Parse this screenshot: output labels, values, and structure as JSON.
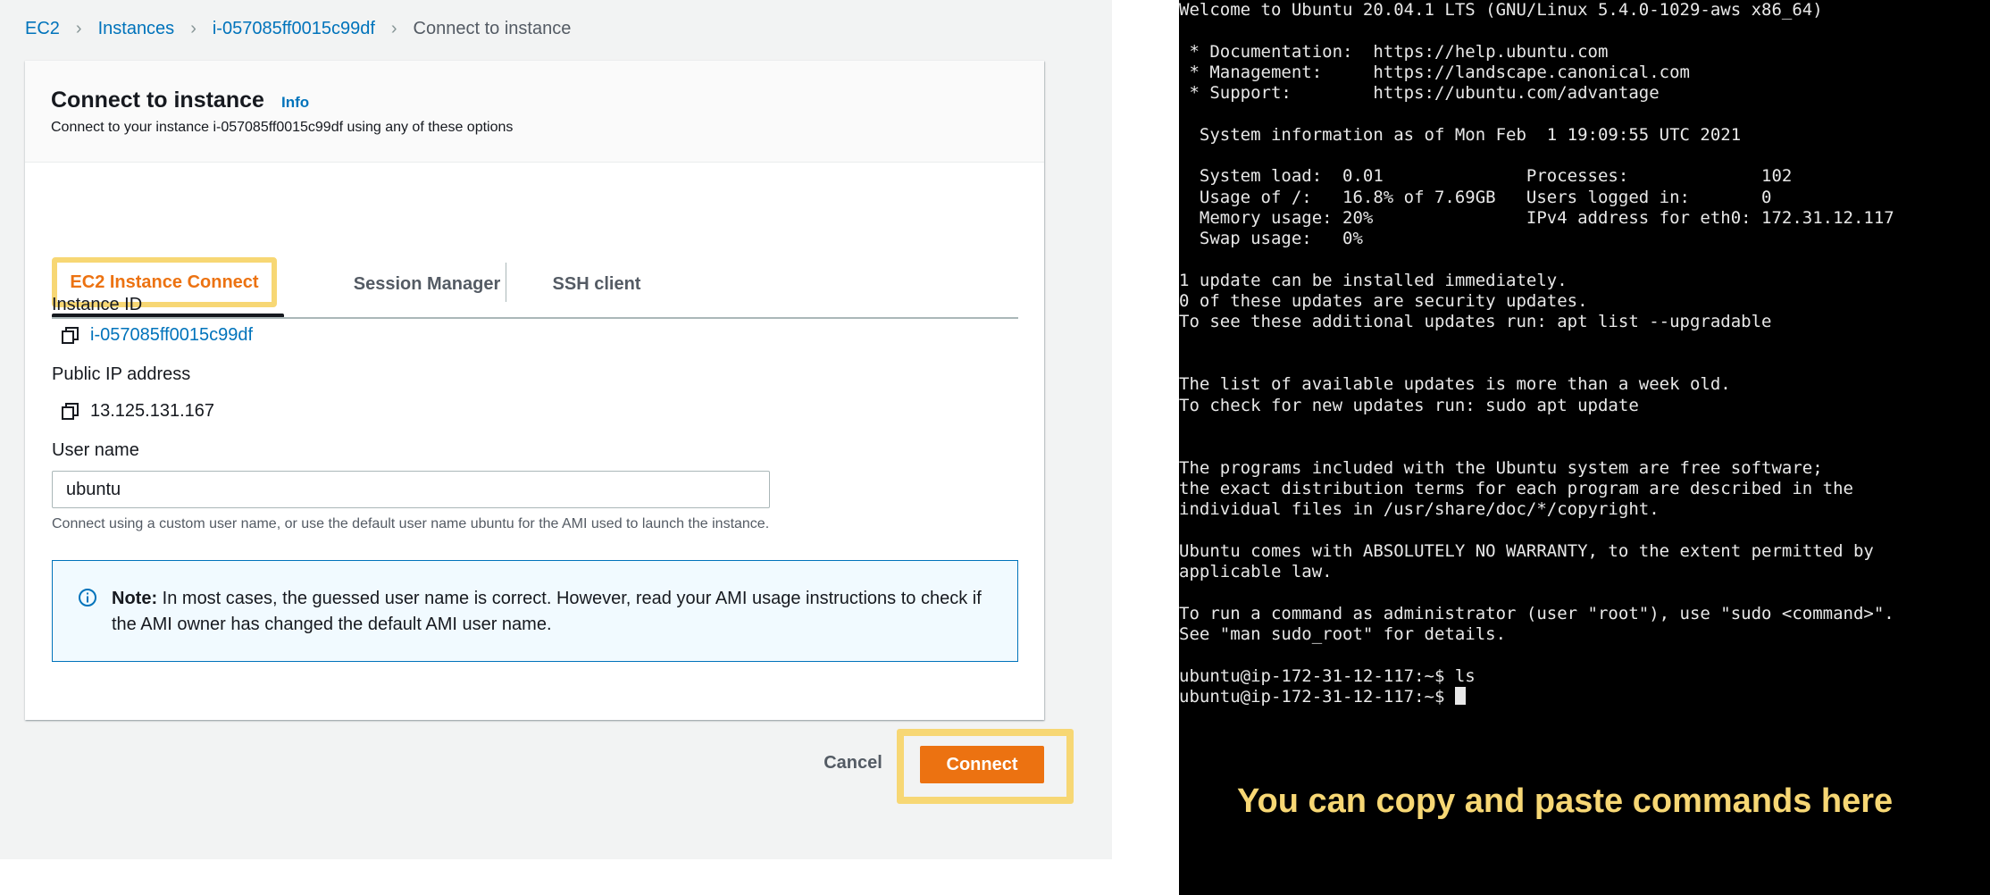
{
  "breadcrumb": {
    "items": [
      "EC2",
      "Instances",
      "i-057085ff0015c99df"
    ],
    "current": "Connect to instance"
  },
  "card": {
    "title": "Connect to instance",
    "info_link": "Info",
    "description": "Connect to your instance i-057085ff0015c99df using any of these options"
  },
  "tabs": [
    {
      "label": "EC2 Instance Connect",
      "selected": true
    },
    {
      "label": "Session Manager",
      "selected": false
    },
    {
      "label": "SSH client",
      "selected": false
    }
  ],
  "fields": {
    "instance_id_label": "Instance ID",
    "instance_id_value": "i-057085ff0015c99df",
    "public_ip_label": "Public IP address",
    "public_ip_value": "13.125.131.167",
    "username_label": "User name",
    "username_value": "ubuntu",
    "username_hint": "Connect using a custom user name, or use the default user name ubuntu for the AMI used to launch the instance."
  },
  "note": {
    "bold": "Note:",
    "text": " In most cases, the guessed user name is correct. However, read your AMI usage instructions to check if the AMI owner has changed the default AMI user name."
  },
  "actions": {
    "cancel_label": "Cancel",
    "connect_label": "Connect"
  },
  "colors": {
    "accent_orange": "#ec7211",
    "link_blue": "#0073bb",
    "highlight_yellow": "#f7d774",
    "terminal_bg": "#000000"
  },
  "icons": [
    "copy-icon",
    "info-circle-icon",
    "chevron-right-icon",
    "terminal-cursor"
  ],
  "terminal": {
    "lines": [
      "Welcome to Ubuntu 20.04.1 LTS (GNU/Linux 5.4.0-1029-aws x86_64)",
      "",
      " * Documentation:  https://help.ubuntu.com",
      " * Management:     https://landscape.canonical.com",
      " * Support:        https://ubuntu.com/advantage",
      "",
      "  System information as of Mon Feb  1 19:09:55 UTC 2021",
      "",
      "  System load:  0.01              Processes:             102",
      "  Usage of /:   16.8% of 7.69GB   Users logged in:       0",
      "  Memory usage: 20%               IPv4 address for eth0: 172.31.12.117",
      "  Swap usage:   0%",
      "",
      "1 update can be installed immediately.",
      "0 of these updates are security updates.",
      "To see these additional updates run: apt list --upgradable",
      "",
      "",
      "The list of available updates is more than a week old.",
      "To check for new updates run: sudo apt update",
      "",
      "",
      "The programs included with the Ubuntu system are free software;",
      "the exact distribution terms for each program are described in the",
      "individual files in /usr/share/doc/*/copyright.",
      "",
      "Ubuntu comes with ABSOLUTELY NO WARRANTY, to the extent permitted by",
      "applicable law.",
      "",
      "To run a command as administrator (user \"root\"), use \"sudo <command>\".",
      "See \"man sudo_root\" for details.",
      "",
      "ubuntu@ip-172-31-12-117:~$ ls"
    ],
    "prompt": "ubuntu@ip-172-31-12-117:~$ ",
    "caption": "You can copy and paste commands here"
  }
}
